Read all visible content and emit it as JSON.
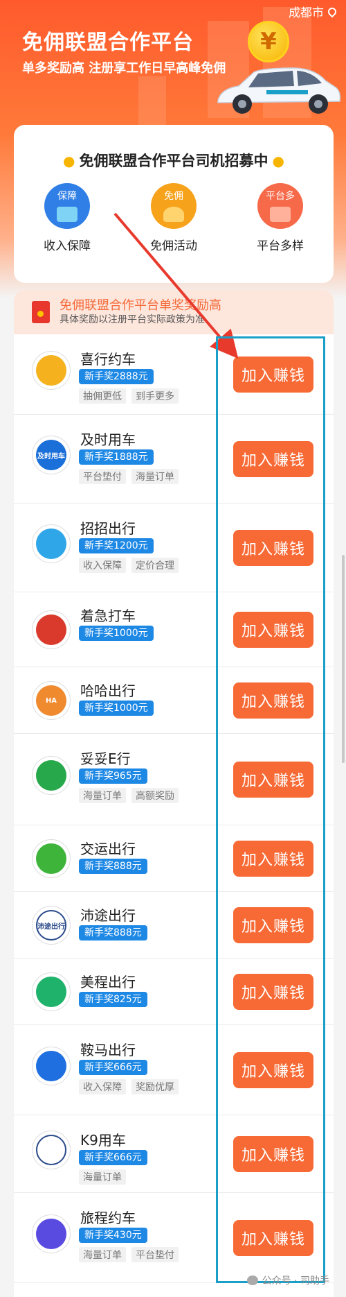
{
  "header": {
    "city": "成都市",
    "title": "免佣联盟合作平台",
    "subtitle": "单多奖励高 注册享工作日早高峰免佣",
    "coin_symbol": "¥"
  },
  "recruit": {
    "title": "免佣联盟合作平台司机招募中",
    "features": [
      {
        "icon_text": "保障",
        "label": "收入保障",
        "color": "#2f7fe6",
        "icon": "shield-icon"
      },
      {
        "icon_text": "免佣",
        "label": "免佣活动",
        "color": "#f7a21b",
        "icon": "rocket-icon"
      },
      {
        "icon_text": "平台多",
        "label": "平台多样",
        "color": "#f66a4a",
        "icon": "arrows-icon"
      }
    ]
  },
  "banner": {
    "title": "免佣联盟合作平台单奖奖励高",
    "note": "具体奖励以注册平台实际政策为准"
  },
  "platforms": [
    {
      "name": "喜行约车",
      "bonus": "新手奖2888元",
      "tags": [
        "抽佣更低",
        "到手更多"
      ],
      "button": "加入赚钱",
      "logo_color": "#f5b21e",
      "logo_text": "",
      "logo_icon": "bird-icon"
    },
    {
      "name": "及时用车",
      "bonus": "新手奖1888元",
      "tags": [
        "平台垫付",
        "海量订单"
      ],
      "button": "加入赚钱",
      "logo_color": "#1a6fd8",
      "logo_text": "及时用车",
      "logo_icon": "car-icon"
    },
    {
      "name": "招招出行",
      "bonus": "新手奖1200元",
      "tags": [
        "收入保障",
        "定价合理"
      ],
      "button": "加入赚钱",
      "logo_color": "#2fa6e8",
      "logo_text": "",
      "logo_icon": "swirl-icon"
    },
    {
      "name": "着急打车",
      "bonus": "新手奖1000元",
      "tags": [],
      "button": "加入赚钱",
      "logo_color": "#d93a2b",
      "logo_text": "",
      "logo_icon": "e-letter-icon"
    },
    {
      "name": "哈哈出行",
      "bonus": "新手奖1000元",
      "tags": [],
      "button": "加入赚钱",
      "logo_color": "#f08a2e",
      "logo_text": "HA",
      "logo_icon": "ha-logo-icon"
    },
    {
      "name": "妥妥E行",
      "bonus": "新手奖965元",
      "tags": [
        "海量订单",
        "高额奖励"
      ],
      "button": "加入赚钱",
      "logo_color": "#27a84a",
      "logo_text": "",
      "logo_icon": "shirt-icon"
    },
    {
      "name": "交运出行",
      "bonus": "新手奖888元",
      "tags": [],
      "button": "加入赚钱",
      "logo_color": "#3fb43b",
      "logo_text": "",
      "logo_icon": "road-icon"
    },
    {
      "name": "沛途出行",
      "bonus": "新手奖888元",
      "tags": [],
      "button": "加入赚钱",
      "logo_color": "#ffffff",
      "logo_text": "沛途出行",
      "logo_icon": "text-logo-icon"
    },
    {
      "name": "美程出行",
      "bonus": "新手奖825元",
      "tags": [],
      "button": "加入赚钱",
      "logo_color": "#1fb26a",
      "logo_text": "",
      "logo_icon": "arch-icon"
    },
    {
      "name": "鞍马出行",
      "bonus": "新手奖666元",
      "tags": [
        "收入保障",
        "奖励优厚"
      ],
      "button": "加入赚钱",
      "logo_color": "#1f6fe0",
      "logo_text": "",
      "logo_icon": "horse-icon"
    },
    {
      "name": "K9用车",
      "bonus": "新手奖666元",
      "tags": [
        "海量订单"
      ],
      "button": "加入赚钱",
      "logo_color": "#ffffff",
      "logo_text": "",
      "logo_icon": "k9-icon"
    },
    {
      "name": "旅程约车",
      "bonus": "新手奖430元",
      "tags": [
        "海量订单",
        "平台垫付"
      ],
      "button": "加入赚钱",
      "logo_color": "#5a4be0",
      "logo_text": "",
      "logo_icon": "bus-icon"
    }
  ],
  "watermark": "公众号 · 司助手"
}
